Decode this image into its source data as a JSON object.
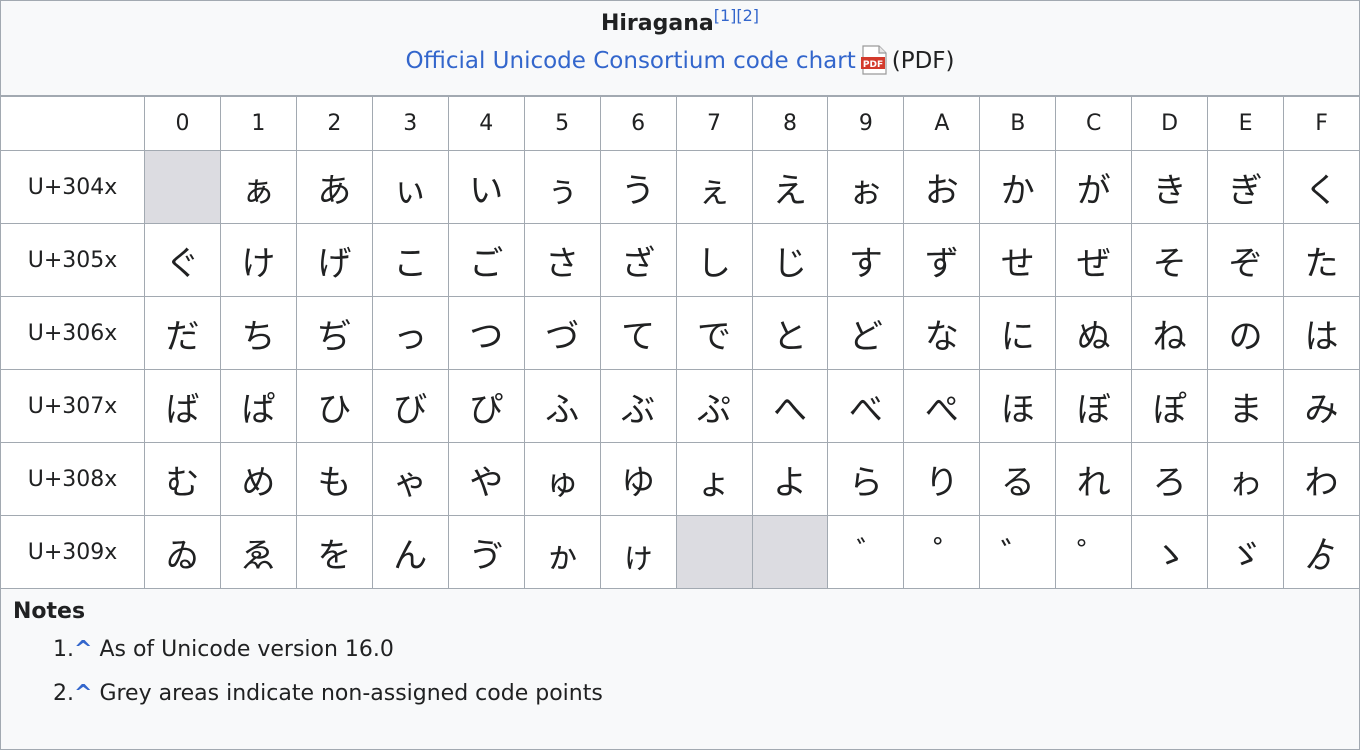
{
  "caption": {
    "title": "Hiragana",
    "refs": [
      "[1]",
      "[2]"
    ],
    "chart_link": "Official Unicode Consortium code chart",
    "pdf_suffix": "(PDF)"
  },
  "columns": [
    "0",
    "1",
    "2",
    "3",
    "4",
    "5",
    "6",
    "7",
    "8",
    "9",
    "A",
    "B",
    "C",
    "D",
    "E",
    "F"
  ],
  "rows": [
    {
      "label": "U+304x",
      "cells": [
        "",
        "ぁ",
        "あ",
        "ぃ",
        "い",
        "ぅ",
        "う",
        "ぇ",
        "え",
        "ぉ",
        "お",
        "か",
        "が",
        "き",
        "ぎ",
        "く"
      ]
    },
    {
      "label": "U+305x",
      "cells": [
        "ぐ",
        "け",
        "げ",
        "こ",
        "ご",
        "さ",
        "ざ",
        "し",
        "じ",
        "す",
        "ず",
        "せ",
        "ぜ",
        "そ",
        "ぞ",
        "た"
      ]
    },
    {
      "label": "U+306x",
      "cells": [
        "だ",
        "ち",
        "ぢ",
        "っ",
        "つ",
        "づ",
        "て",
        "で",
        "と",
        "ど",
        "な",
        "に",
        "ぬ",
        "ね",
        "の",
        "は"
      ]
    },
    {
      "label": "U+307x",
      "cells": [
        "ば",
        "ぱ",
        "ひ",
        "び",
        "ぴ",
        "ふ",
        "ぶ",
        "ぷ",
        "へ",
        "べ",
        "ぺ",
        "ほ",
        "ぼ",
        "ぽ",
        "ま",
        "み"
      ]
    },
    {
      "label": "U+308x",
      "cells": [
        "む",
        "め",
        "も",
        "ゃ",
        "や",
        "ゅ",
        "ゆ",
        "ょ",
        "よ",
        "ら",
        "り",
        "る",
        "れ",
        "ろ",
        "ゎ",
        "わ"
      ]
    },
    {
      "label": "U+309x",
      "cells": [
        "ゐ",
        "ゑ",
        "を",
        "ん",
        "ゔ",
        "ゕ",
        "ゖ",
        "",
        "",
        "゙",
        "゚",
        "゛",
        "゜",
        "ゝ",
        "ゞ",
        "ゟ"
      ]
    }
  ],
  "unassigned": [
    [
      0,
      0
    ],
    [
      5,
      7
    ],
    [
      5,
      8
    ]
  ],
  "notes": {
    "title": "Notes",
    "items": [
      {
        "num": "1.",
        "caret": "^",
        "text": "As of Unicode version 16.0"
      },
      {
        "num": "2.",
        "caret": "^",
        "text": "Grey areas indicate non-assigned code points"
      }
    ]
  },
  "colors": {
    "link": "#3366cc",
    "unassigned": "#dcdce1",
    "border": "#a2a9b1"
  }
}
